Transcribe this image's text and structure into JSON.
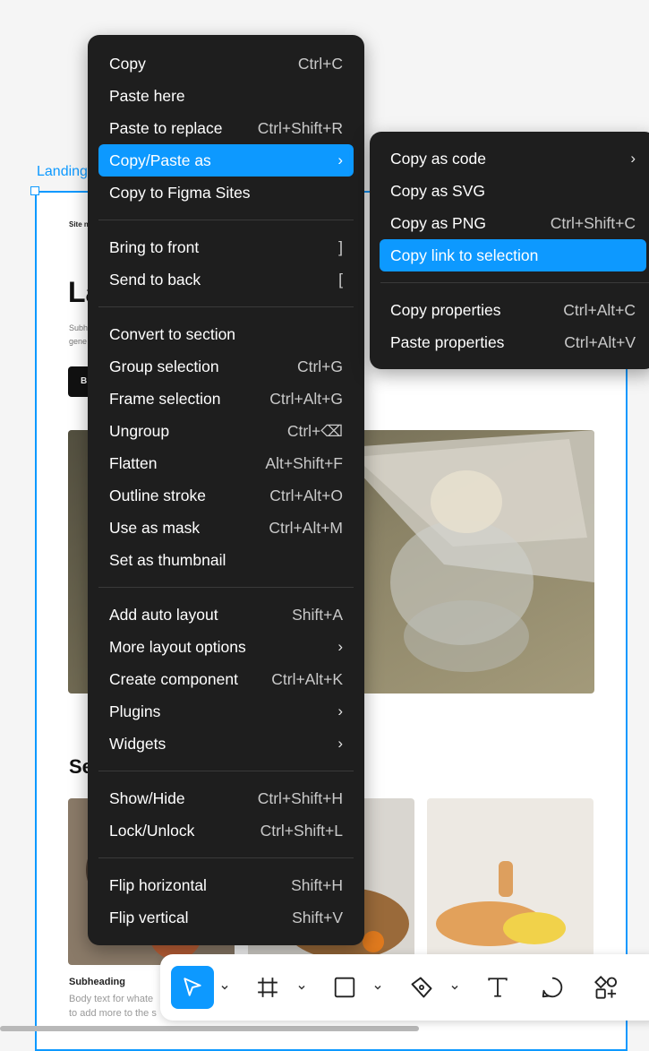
{
  "canvas": {
    "frame_label": "Landing",
    "site_name": "Site n",
    "hero_title": "La",
    "hero_subtitle": "Subh\ngene",
    "hero_button": "B",
    "section_title": "Se",
    "card": {
      "heading": "Subheading",
      "body": "Body text for whate\nto add more to the s"
    }
  },
  "context_menu": {
    "groups": [
      [
        {
          "label": "Copy",
          "shortcut": "Ctrl+C"
        },
        {
          "label": "Paste here",
          "shortcut": ""
        },
        {
          "label": "Paste to replace",
          "shortcut": "Ctrl+Shift+R"
        },
        {
          "label": "Copy/Paste as",
          "shortcut": "",
          "submenu": true,
          "active": true
        },
        {
          "label": "Copy to Figma Sites",
          "shortcut": ""
        }
      ],
      [
        {
          "label": "Bring to front",
          "shortcut": "]"
        },
        {
          "label": "Send to back",
          "shortcut": "["
        }
      ],
      [
        {
          "label": "Convert to section",
          "shortcut": ""
        },
        {
          "label": "Group selection",
          "shortcut": "Ctrl+G"
        },
        {
          "label": "Frame selection",
          "shortcut": "Ctrl+Alt+G"
        },
        {
          "label": "Ungroup",
          "shortcut": "Ctrl+⌫"
        },
        {
          "label": "Flatten",
          "shortcut": "Alt+Shift+F"
        },
        {
          "label": "Outline stroke",
          "shortcut": "Ctrl+Alt+O"
        },
        {
          "label": "Use as mask",
          "shortcut": "Ctrl+Alt+M"
        },
        {
          "label": "Set as thumbnail",
          "shortcut": ""
        }
      ],
      [
        {
          "label": "Add auto layout",
          "shortcut": "Shift+A"
        },
        {
          "label": "More layout options",
          "shortcut": "",
          "submenu": true
        },
        {
          "label": "Create component",
          "shortcut": "Ctrl+Alt+K"
        },
        {
          "label": "Plugins",
          "shortcut": "",
          "submenu": true
        },
        {
          "label": "Widgets",
          "shortcut": "",
          "submenu": true
        }
      ],
      [
        {
          "label": "Show/Hide",
          "shortcut": "Ctrl+Shift+H"
        },
        {
          "label": "Lock/Unlock",
          "shortcut": "Ctrl+Shift+L"
        }
      ],
      [
        {
          "label": "Flip horizontal",
          "shortcut": "Shift+H"
        },
        {
          "label": "Flip vertical",
          "shortcut": "Shift+V"
        }
      ]
    ]
  },
  "submenu": {
    "groups": [
      [
        {
          "label": "Copy as code",
          "shortcut": "",
          "submenu": true
        },
        {
          "label": "Copy as SVG",
          "shortcut": ""
        },
        {
          "label": "Copy as PNG",
          "shortcut": "Ctrl+Shift+C"
        },
        {
          "label": "Copy link to selection",
          "shortcut": "",
          "active": true
        }
      ],
      [
        {
          "label": "Copy properties",
          "shortcut": "Ctrl+Alt+C"
        },
        {
          "label": "Paste properties",
          "shortcut": "Ctrl+Alt+V"
        }
      ]
    ]
  },
  "toolbar": {
    "tools": [
      {
        "name": "move-tool",
        "icon": "cursor-icon",
        "selected": true,
        "caret": true
      },
      {
        "name": "frame-tool",
        "icon": "frame-icon",
        "caret": true
      },
      {
        "name": "rectangle-tool",
        "icon": "rectangle-icon",
        "caret": true
      },
      {
        "name": "pen-tool",
        "icon": "pen-icon",
        "caret": true
      },
      {
        "name": "text-tool",
        "icon": "text-icon"
      },
      {
        "name": "comment-tool",
        "icon": "comment-icon"
      },
      {
        "name": "actions-tool",
        "icon": "shapes-icon"
      }
    ]
  },
  "colors": {
    "accent": "#0d99ff",
    "menu_bg": "#1e1e1e",
    "menu_text": "#ffffff",
    "shortcut_text": "#c9c9c9"
  }
}
